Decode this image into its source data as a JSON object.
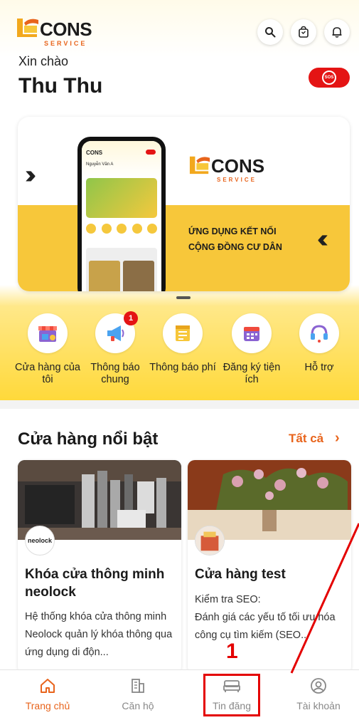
{
  "brand": {
    "name": "CONS",
    "sub": "SERVICE"
  },
  "greeting": "Xin chào",
  "user_name": "Thu Thu",
  "sos_label": "SOS",
  "banner": {
    "slogan_line1": "ỨNG DỤNG KẾT NỐI",
    "slogan_line2": "CỘNG ĐỒNG CƯ DÂN",
    "brand": "CONS",
    "brand_sub": "SERVICE",
    "phone_user": "Nguyễn Văn A"
  },
  "menu": [
    {
      "label": "Cửa hàng của tôi",
      "icon": "store-icon"
    },
    {
      "label": "Thông báo chung",
      "icon": "megaphone-icon",
      "badge": "1"
    },
    {
      "label": "Thông báo phí",
      "icon": "bill-icon"
    },
    {
      "label": "Đăng ký tiện ích",
      "icon": "calendar-icon"
    },
    {
      "label": "Hỗ trợ",
      "icon": "headset-icon"
    }
  ],
  "featured": {
    "title": "Cửa hàng nổi bật",
    "see_all": "Tất cả",
    "cards": [
      {
        "title": "Khóa cửa thông minh neolock",
        "avatar_text": "neolock",
        "desc": "Hệ thống khóa cửa thông minh Neolock quản lý khóa thông qua ứng dụng di độn..."
      },
      {
        "title": "Cửa hàng test",
        "desc_line1": "Kiểm tra SEO:",
        "desc_line2": "Đánh giá các yếu tố tối ưu hóa công cụ tìm kiếm (SEO..."
      }
    ]
  },
  "bottom_nav": [
    {
      "label": "Trang chủ",
      "icon": "home-icon",
      "active": true
    },
    {
      "label": "Căn hộ",
      "icon": "building-icon",
      "active": false
    },
    {
      "label": "Tin đăng",
      "icon": "bed-icon",
      "active": false
    },
    {
      "label": "Tài khoản",
      "icon": "account-icon",
      "active": false
    }
  ],
  "annotation": {
    "number": "1"
  },
  "colors": {
    "accent": "#e8641c",
    "banner_yellow": "#f7c73a",
    "sos_red": "#e41414",
    "annotation_red": "#e40000"
  }
}
